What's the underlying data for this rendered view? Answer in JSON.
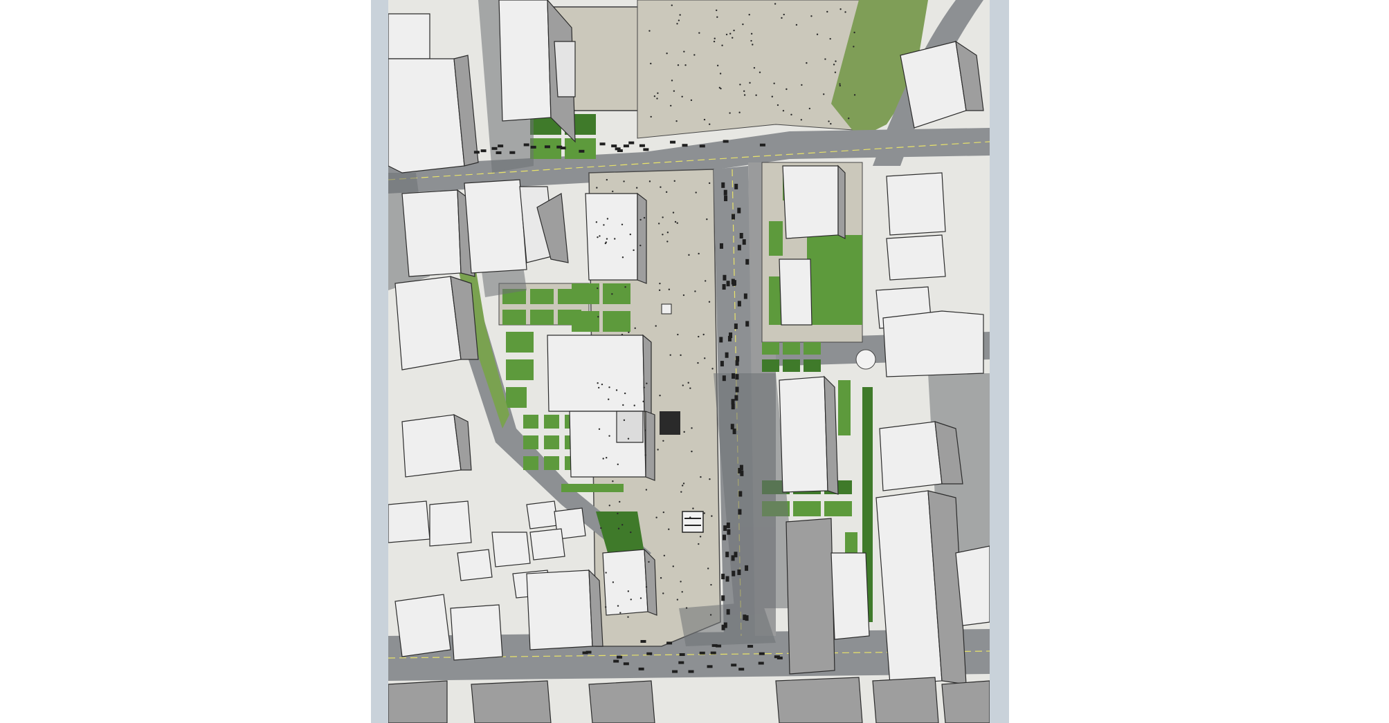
{
  "image": {
    "kind": "aerial urban master plan rendering",
    "colors": {
      "background": "#ffffff",
      "frame": "#c9d2da",
      "plaza": "#cbc8bb",
      "road": "#8d9093",
      "building_roof": "#efefef",
      "building_side": "#9e9e9e",
      "green": "#5d9a3c",
      "dark_green": "#3f7a2a",
      "shadow": "#6e7175",
      "car": "#1f1f1f",
      "lane_marking": "#e9e36a"
    },
    "icons": [
      "plaza-kiosk-icon",
      "plaza-entrance-icon"
    ]
  }
}
